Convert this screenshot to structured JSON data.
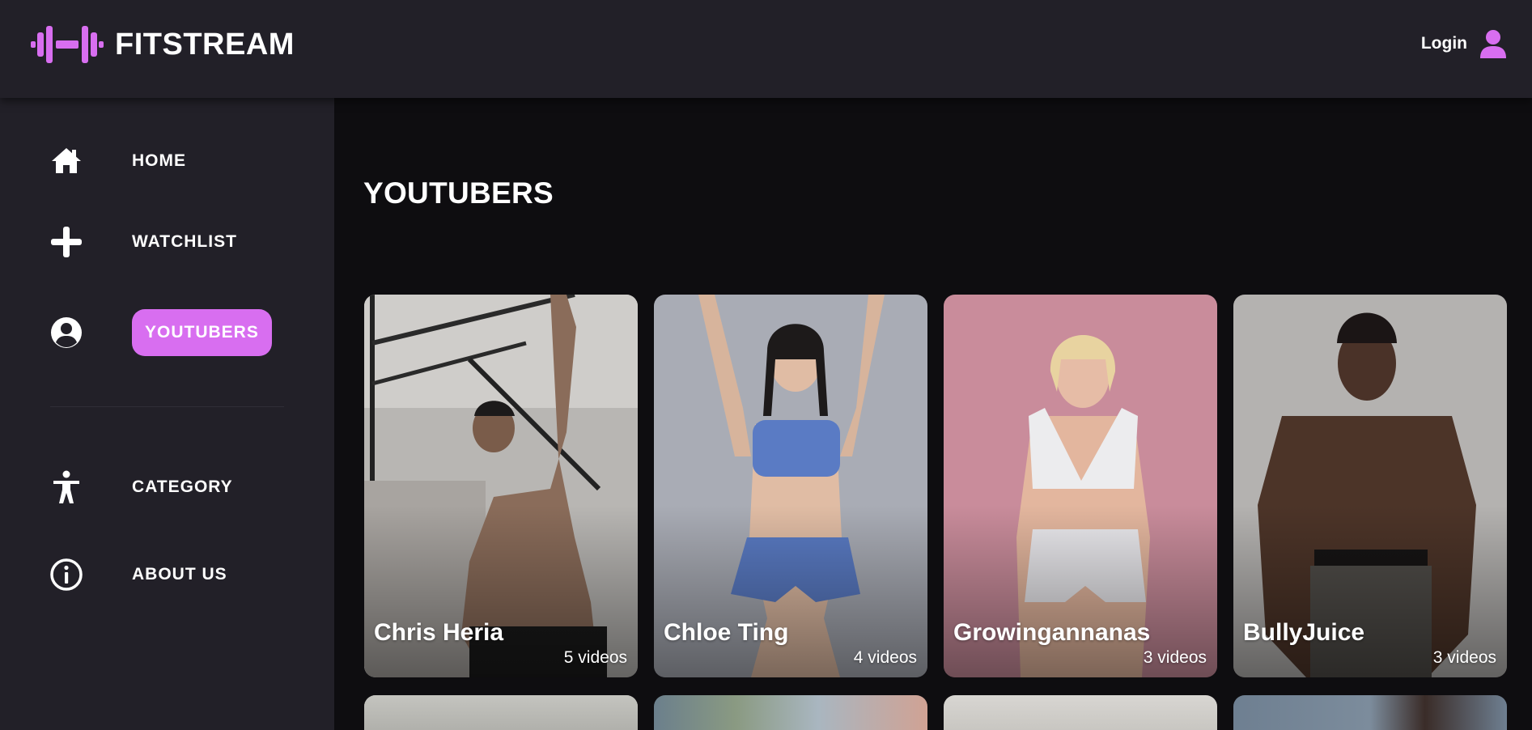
{
  "app": {
    "name": "FITSTREAM",
    "accent_color": "#d86ef0",
    "logo_icon": "dumbbell-icon"
  },
  "header": {
    "login_label": "Login",
    "login_icon": "user-icon"
  },
  "sidebar": {
    "items": [
      {
        "label": "HOME",
        "icon": "home-icon",
        "active": false
      },
      {
        "label": "WATCHLIST",
        "icon": "plus-icon",
        "active": false
      },
      {
        "label": "YOUTUBERS",
        "icon": "user-circle-icon",
        "active": true
      },
      {
        "label": "CATEGORY",
        "icon": "accessibility-icon",
        "active": false
      },
      {
        "label": "ABOUT US",
        "icon": "info-icon",
        "active": false
      }
    ]
  },
  "main": {
    "title": "YOUTUBERS",
    "cards": [
      {
        "name": "Chris Heria",
        "count": "5 videos"
      },
      {
        "name": "Chloe Ting",
        "count": "4 videos"
      },
      {
        "name": "Growingannanas",
        "count": "3 videos"
      },
      {
        "name": "BullyJuice",
        "count": "3 videos"
      }
    ]
  }
}
